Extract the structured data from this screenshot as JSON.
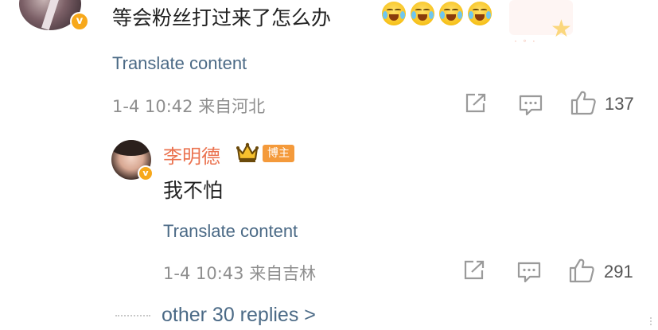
{
  "comment": {
    "text": "等会粉丝打过来了怎么办",
    "emoji": [
      "laughing-crying-emoji",
      "laughing-crying-emoji",
      "laughing-crying-emoji",
      "laughing-crying-emoji"
    ],
    "translate_label": "Translate content",
    "timestamp": "1-4 10:42",
    "location": "来自河北",
    "like_count": "137"
  },
  "reply": {
    "username": "李明德",
    "author_tag": "博主",
    "text": "我不怕",
    "translate_label": "Translate content",
    "timestamp": "1-4 10:43",
    "location": "来自吉林",
    "like_count": "291"
  },
  "more_replies": {
    "label": "other 30 replies >"
  },
  "colors": {
    "link": "#4b6a86",
    "username": "#eb7350",
    "author_tag": "#f49a3b",
    "verified": "#f7a81b",
    "meta": "#8f8f8f"
  },
  "icons": {
    "share": "share-icon",
    "comment": "comment-icon",
    "like": "thumbs-up-icon",
    "verified": "verified-badge-icon",
    "crown": "crown-icon"
  }
}
